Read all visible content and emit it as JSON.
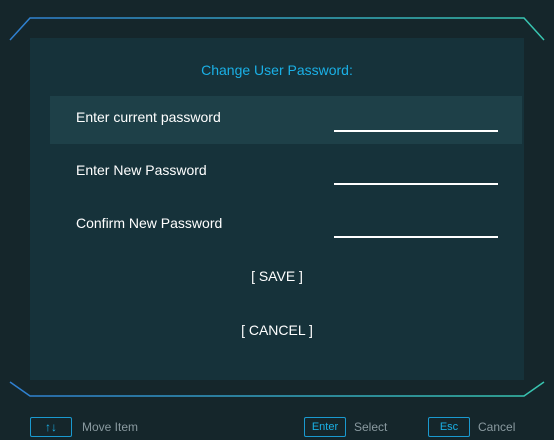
{
  "dialog": {
    "title": "Change User Password:",
    "fields": [
      {
        "label": "Enter current password",
        "value": ""
      },
      {
        "label": "Enter New Password",
        "value": ""
      },
      {
        "label": "Confirm New Password",
        "value": ""
      }
    ],
    "save_label": "[ SAVE ]",
    "cancel_label": "[ CANCEL ]"
  },
  "footer": {
    "move": {
      "key": "↑↓",
      "label": "Move Item"
    },
    "select": {
      "key": "Enter",
      "label": "Select"
    },
    "cancel": {
      "key": "Esc",
      "label": "Cancel"
    }
  },
  "colors": {
    "background": "#15262b",
    "panel": "#16323a",
    "selected_row": "#1e4048",
    "accent": "#1ab0e6",
    "frame_top": "#2f7fd1",
    "frame_top_end": "#38c6b0",
    "text": "#ffffff",
    "hint_text": "#8a9aa0"
  }
}
